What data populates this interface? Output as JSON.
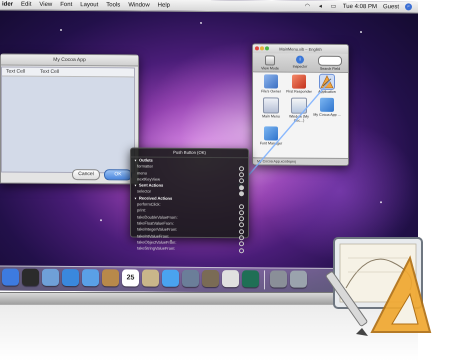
{
  "menubar": {
    "app": "ider",
    "items": [
      "Edit",
      "View",
      "Font",
      "Layout",
      "Tools",
      "Window",
      "Help"
    ],
    "clock": "Tue 4:08 PM",
    "user": "Guest"
  },
  "app_window": {
    "title": "My Cocoa App",
    "columns": [
      "Text Cell",
      "Text Cell"
    ],
    "cancel_label": "Cancel",
    "ok_label": "OK"
  },
  "project_window": {
    "title": "MainMenu.xib – English",
    "toolbar": {
      "view_mode": "View Mode",
      "inspector": "Inspector",
      "search": "Search Field"
    },
    "objects": [
      {
        "label": "File's Owner",
        "icon": "cube-icon",
        "color": "#4a7fd0"
      },
      {
        "label": "First Responder",
        "icon": "red-cube-icon",
        "color": "#d9452b"
      },
      {
        "label": "Application",
        "icon": "app-icon",
        "color": "#e68f2c"
      },
      {
        "label": "Main Menu",
        "icon": "menu-icon",
        "color": "#7d8cb0"
      },
      {
        "label": "Window (My Coc...)",
        "icon": "window-icon",
        "color": "#9fb6d8"
      },
      {
        "label": "My Cocoa App ...",
        "icon": "cube-icon",
        "color": "#3a8ee0"
      },
      {
        "label": "Font Manager",
        "icon": "cube-icon",
        "color": "#3e86dc"
      }
    ],
    "status": "My Cocoa App.xcodeproj"
  },
  "hud": {
    "title": "Push Button (OK)",
    "rows": [
      {
        "label": "Outlets",
        "section": true
      },
      {
        "label": "formatter",
        "dot": "empty"
      },
      {
        "label": "menu",
        "dot": "empty"
      },
      {
        "label": "nextKeyView",
        "dot": "empty"
      },
      {
        "label": "Sent Actions",
        "section": true,
        "dot": "filled"
      },
      {
        "label": "selector",
        "dot": "filled"
      },
      {
        "label": "Received Actions",
        "section": true
      },
      {
        "label": "performClick:",
        "dot": "empty"
      },
      {
        "label": "print:",
        "dot": "empty"
      },
      {
        "label": "takeDoubleValueFrom:",
        "dot": "empty"
      },
      {
        "label": "takeFloatValueFrom:",
        "dot": "empty"
      },
      {
        "label": "takeIntegerValueFrom:",
        "dot": "empty"
      },
      {
        "label": "takeIntValueFrom:",
        "dot": "empty"
      },
      {
        "label": "takeObjectValueFrom:",
        "dot": "empty"
      },
      {
        "label": "takeStringValueFrom:",
        "dot": "empty"
      }
    ]
  },
  "dock": {
    "calendar_day": "25",
    "items": [
      {
        "icon": "finder-icon",
        "color": "#3d7be0"
      },
      {
        "icon": "dashboard-icon",
        "color": "#2b2b2b"
      },
      {
        "icon": "mail-icon",
        "color": "#6fa0d8"
      },
      {
        "icon": "safari-icon",
        "color": "#3a88dd"
      },
      {
        "icon": "ichat-icon",
        "color": "#5aa0e6"
      },
      {
        "icon": "address-book-icon",
        "color": "#b8894a"
      },
      {
        "icon": "calendar-icon",
        "color": "#ffffff"
      },
      {
        "icon": "preview-icon",
        "color": "#c9b68a"
      },
      {
        "icon": "itunes-icon",
        "color": "#4aa3ef"
      },
      {
        "icon": "iphoto-icon",
        "color": "#6b7e99"
      },
      {
        "icon": "imovie-icon",
        "color": "#7a6b55"
      },
      {
        "icon": "garageband-icon",
        "color": "#e0e0e0"
      },
      {
        "icon": "time-machine-icon",
        "color": "#1f6f55"
      },
      {
        "icon": "system-preferences-icon",
        "color": "#8a8f98"
      },
      {
        "icon": "xcode-icon",
        "color": "#9aa3ad"
      }
    ]
  },
  "colors": {
    "accent_blue": "#4a86de",
    "hud_background": "#191919",
    "connection_line": "#7fb2ff"
  }
}
